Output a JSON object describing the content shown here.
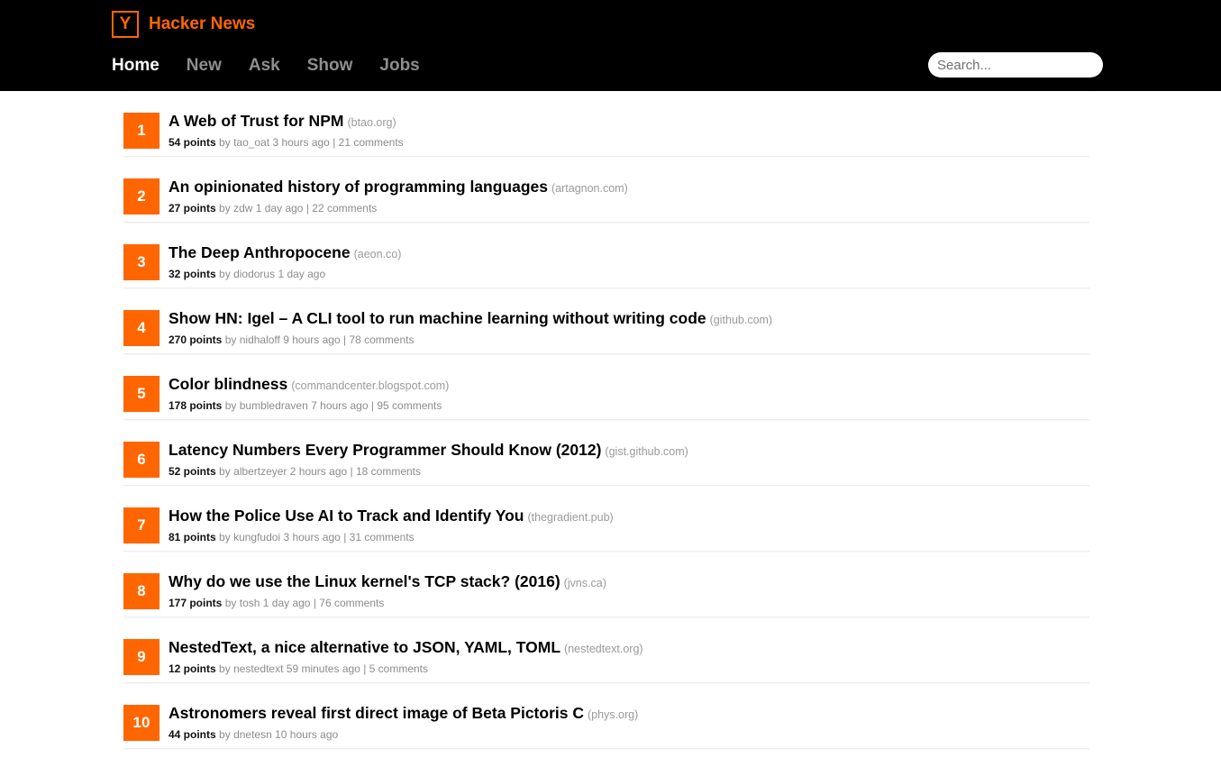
{
  "header": {
    "logo_letter": "Y",
    "site_name": "Hacker News",
    "brand_color": "#ff6600",
    "nav": [
      {
        "label": "Home",
        "active": true
      },
      {
        "label": "New",
        "active": false
      },
      {
        "label": "Ask",
        "active": false
      },
      {
        "label": "Show",
        "active": false
      },
      {
        "label": "Jobs",
        "active": false
      }
    ],
    "search_placeholder": "Search..."
  },
  "stories": [
    {
      "rank": "1",
      "title": "A Web of Trust for NPM",
      "domain": "(btao.org)",
      "points": "54 points",
      "by": "by",
      "user": "tao_oat",
      "age": "3 hours ago",
      "sep": "|",
      "comments": "21 comments"
    },
    {
      "rank": "2",
      "title": "An opinionated history of programming languages",
      "domain": "(artagnon.com)",
      "points": "27 points",
      "by": "by",
      "user": "zdw",
      "age": "1 day ago",
      "sep": "|",
      "comments": "22 comments"
    },
    {
      "rank": "3",
      "title": "The Deep Anthropocene",
      "domain": "(aeon.co)",
      "points": "32 points",
      "by": "by",
      "user": "diodorus",
      "age": "1 day ago",
      "sep": "",
      "comments": ""
    },
    {
      "rank": "4",
      "title": "Show HN: Igel – A CLI tool to run machine learning without writing code",
      "domain": "(github.com)",
      "points": "270 points",
      "by": "by",
      "user": "nidhaloff",
      "age": "9 hours ago",
      "sep": "|",
      "comments": "78 comments"
    },
    {
      "rank": "5",
      "title": "Color blindness",
      "domain": "(commandcenter.blogspot.com)",
      "points": "178 points",
      "by": "by",
      "user": "bumbledraven",
      "age": "7 hours ago",
      "sep": "|",
      "comments": "95 comments"
    },
    {
      "rank": "6",
      "title": "Latency Numbers Every Programmer Should Know (2012)",
      "domain": "(gist.github.com)",
      "points": "52 points",
      "by": "by",
      "user": "albertzeyer",
      "age": "2 hours ago",
      "sep": "|",
      "comments": "18 comments"
    },
    {
      "rank": "7",
      "title": "How the Police Use AI to Track and Identify You",
      "domain": "(thegradient.pub)",
      "points": "81 points",
      "by": "by",
      "user": "kungfudoi",
      "age": "3 hours ago",
      "sep": "|",
      "comments": "31 comments"
    },
    {
      "rank": "8",
      "title": "Why do we use the Linux kernel's TCP stack? (2016)",
      "domain": "(jvns.ca)",
      "points": "177 points",
      "by": "by",
      "user": "tosh",
      "age": "1 day ago",
      "sep": "|",
      "comments": "76 comments"
    },
    {
      "rank": "9",
      "title": "NestedText, a nice alternative to JSON, YAML, TOML",
      "domain": "(nestedtext.org)",
      "points": "12 points",
      "by": "by",
      "user": "nestedtext",
      "age": "59 minutes ago",
      "sep": "|",
      "comments": "5 comments"
    },
    {
      "rank": "10",
      "title": "Astronomers reveal first direct image of Beta Pictoris C",
      "domain": "(phys.org)",
      "points": "44 points",
      "by": "by",
      "user": "dnetesn",
      "age": "10 hours ago",
      "sep": "",
      "comments": ""
    }
  ]
}
